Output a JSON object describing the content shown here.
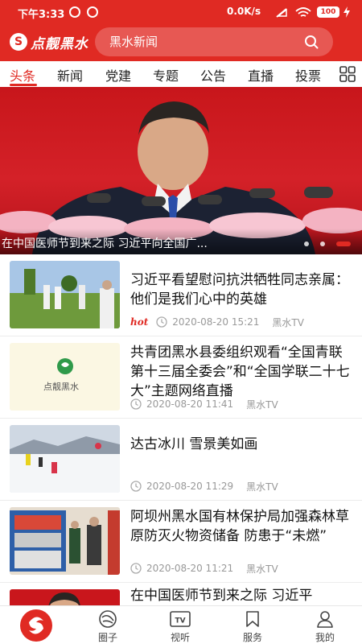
{
  "status_bar": {
    "time": "下午3:33",
    "network_speed": "0.0K/s",
    "battery": "100"
  },
  "header": {
    "logo_text": "点靓黑水",
    "search_placeholder": "黑水新闻"
  },
  "tabs": {
    "items": [
      "头条",
      "新闻",
      "党建",
      "专题",
      "公告",
      "直播",
      "投票"
    ],
    "active": "头条"
  },
  "banner": {
    "caption": "在中国医师节到来之际 习近平向全国广...",
    "slide_count": 3,
    "active_slide": 3
  },
  "news": [
    {
      "title": "习近平看望慰问抗洪牺牲同志亲属：他们是我们心中的英雄",
      "badge": "hot",
      "time": "2020-08-20 15:21",
      "source": "黑水TV"
    },
    {
      "title": "共青团黑水县委组织观看“全国青联第十三届全委会”和“全国学联二十七大”主题网络直播",
      "badge": "",
      "time": "2020-08-20 11:41",
      "source": "黑水TV",
      "thumb_logo_text": "点靓黑水"
    },
    {
      "title": "达古冰川 雪景美如画",
      "badge": "",
      "time": "2020-08-20 11:29",
      "source": "黑水TV"
    },
    {
      "title": "阿坝州黑水国有林保护局加强森林草原防灭火物资储备 防患于“未燃”",
      "badge": "",
      "time": "2020-08-20 11:21",
      "source": "黑水TV"
    },
    {
      "title": "在中国医师节到来之际 习近平"
    }
  ],
  "bottom_nav": {
    "items": [
      "圈子",
      "视听",
      "服务",
      "我的"
    ],
    "tv_label": "TV"
  },
  "colors": {
    "brand_red": "#e02a23",
    "text_dark": "#111111",
    "meta_gray": "#999999"
  }
}
